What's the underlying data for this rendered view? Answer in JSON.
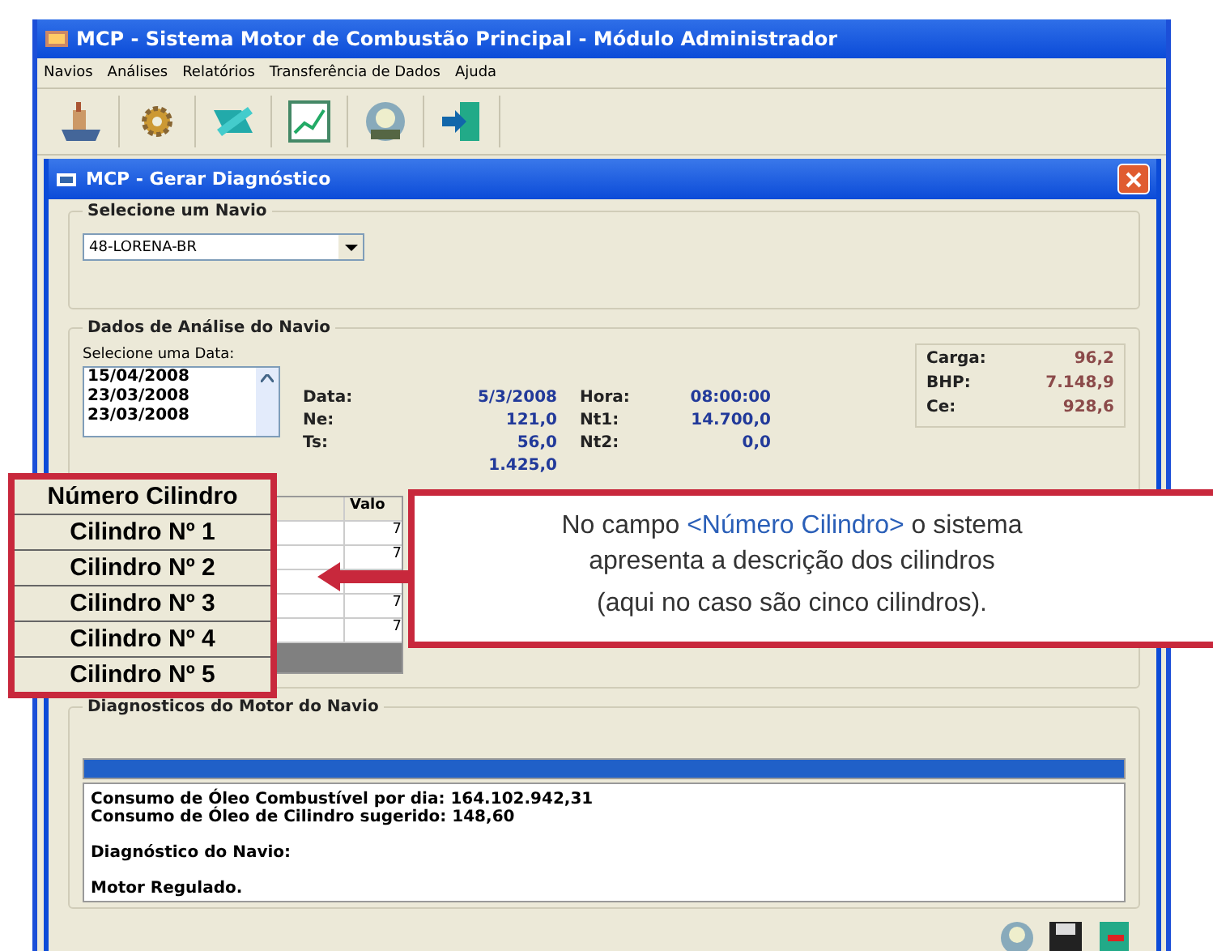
{
  "window": {
    "title": "MCP - Sistema Motor de Combustão Principal - Módulo Administrador"
  },
  "menu": [
    "Navios",
    "Análises",
    "Relatórios",
    "Transferência de Dados",
    "Ajuda"
  ],
  "toolbar": [
    {
      "kind": "ship"
    },
    {
      "kind": "gear"
    },
    {
      "kind": "tools"
    },
    {
      "kind": "chart"
    },
    {
      "kind": "support"
    },
    {
      "kind": "exit"
    }
  ],
  "dialog": {
    "title": "MCP - Gerar Diagnóstico",
    "ship_group": {
      "legend": "Selecione um Navio",
      "value": "48-LORENA-BR"
    },
    "analysis_group": {
      "legend": "Dados de Análise do Navio",
      "date_label": "Selecione uma Data:",
      "dates": [
        "15/04/2008",
        "23/03/2008",
        "23/03/2008"
      ],
      "fields": [
        {
          "label": "Data:",
          "value": "5/3/2008"
        },
        {
          "label": "Hora:",
          "value": "08:00:00"
        },
        {
          "label": "Ne:",
          "value": "121,0"
        },
        {
          "label": "Nt1:",
          "value": "14.700,0"
        },
        {
          "label": "Ts:",
          "value": "56,0"
        },
        {
          "label": "Nt2:",
          "value": "0,0"
        },
        {
          "value": "1.425,0"
        }
      ],
      "summary": [
        {
          "label": "Carga:",
          "value": "96,2"
        },
        {
          "label": "BHP:",
          "value": "7.148,9"
        },
        {
          "label": "Ce:",
          "value": "928,6"
        }
      ],
      "table": {
        "column_2": "Valo",
        "rows": [
          {
            "value": "7"
          },
          {
            "value": "7"
          },
          {},
          {
            "value": "7"
          },
          {
            "value": "7"
          }
        ]
      }
    },
    "diagnosis_group": {
      "legend": "Diagnosticos do Motor do Navio",
      "progress": {
        "level": 1
      },
      "paragraphs": [
        [
          "Consumo de Óleo Combustível por dia: 164.102.942,31",
          "Consumo de Óleo de Cilindro sugerido: 148,60"
        ],
        [
          "Diagnóstico do Navio:"
        ],
        [
          "Motor Regulado."
        ]
      ]
    }
  },
  "bottom_buttons": [
    {
      "kind": "support"
    },
    {
      "kind": "save"
    },
    {
      "kind": "exit"
    }
  ],
  "annotation": {
    "column_header": "Número Cilindro",
    "cylinders": [
      "Cilindro Nº 1",
      "Cilindro Nº 2",
      "Cilindro Nº 3",
      "Cilindro Nº 4",
      "Cilindro Nº 5"
    ],
    "callout_lines": [
      [
        {
          "kind": "plain",
          "text": "No campo "
        },
        {
          "kind": "highlight",
          "text": "<Número Cilindro>"
        },
        {
          "kind": "plain",
          "text": " o sistema"
        }
      ],
      [
        {
          "kind": "plain",
          "text": "apresenta a descrição dos cilindros"
        }
      ],
      [
        {
          "kind": "plain",
          "text": "(aqui no caso são cinco cilindros)."
        }
      ]
    ]
  }
}
